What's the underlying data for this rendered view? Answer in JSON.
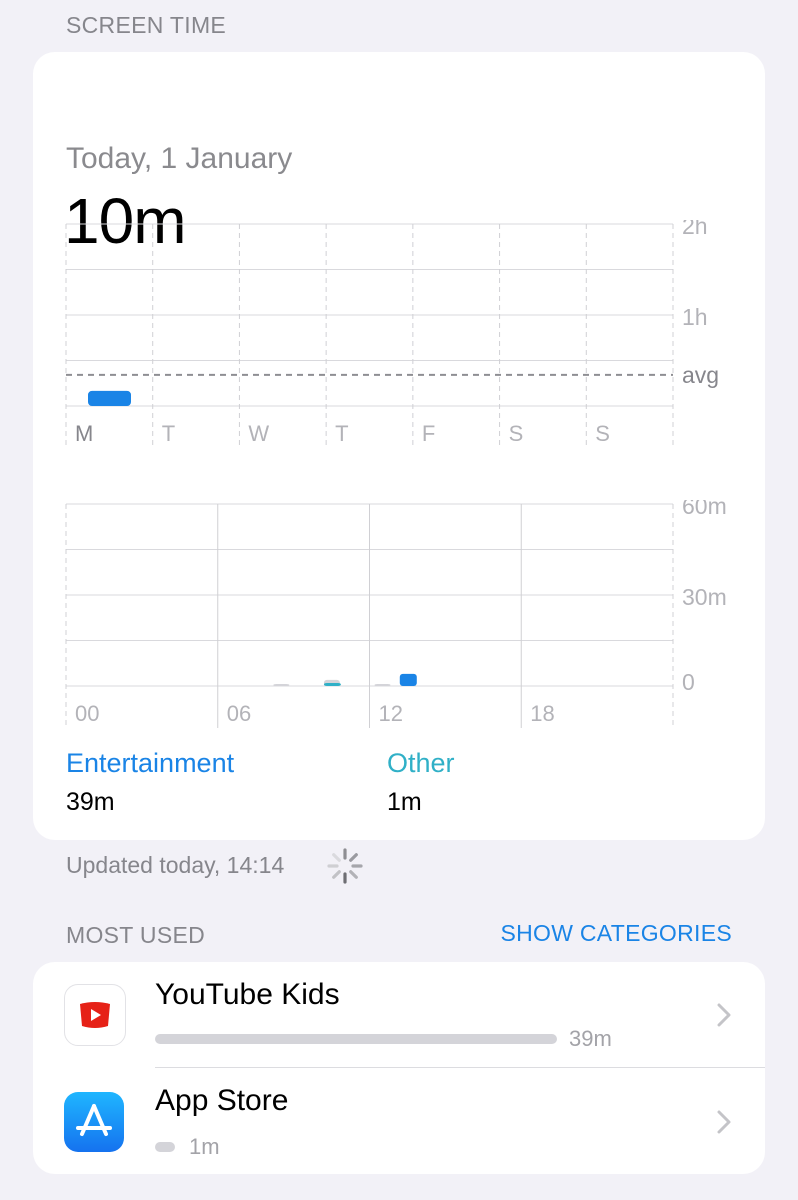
{
  "screen_time": {
    "section_title": "SCREEN TIME",
    "date_label": "Today, 1 January",
    "total": "10m"
  },
  "weekly_chart": {
    "days": [
      "M",
      "T",
      "W",
      "T",
      "F",
      "S",
      "S"
    ],
    "y_tick_labels": [
      "2h",
      "1h"
    ],
    "avg_label": "avg"
  },
  "hourly_chart": {
    "hour_labels": [
      "00",
      "06",
      "12",
      "18"
    ],
    "y_tick_labels": [
      "60m",
      "30m",
      "0"
    ]
  },
  "chart_data": [
    {
      "type": "bar",
      "categories": [
        "M",
        "T",
        "W",
        "T",
        "F",
        "S",
        "S"
      ],
      "values_minutes": [
        10,
        0,
        0,
        0,
        0,
        0,
        0
      ],
      "average_minutes": 10,
      "ylim_minutes": [
        0,
        120
      ],
      "y_ticks": [
        "2h",
        "1h"
      ]
    },
    {
      "type": "bar",
      "x_labels": [
        "00",
        "06",
        "12",
        "18"
      ],
      "ylim_minutes": [
        0,
        60
      ],
      "y_ticks": [
        "60m",
        "30m",
        "0"
      ],
      "series": [
        {
          "name": "Entertainment",
          "color": "#1a84e6",
          "points": [
            {
              "hour": 13,
              "minutes": 4
            }
          ]
        },
        {
          "name": "Other",
          "color": "#30b0c7",
          "points": [
            {
              "hour": 10,
              "minutes": 1
            }
          ]
        }
      ],
      "uncategorized": {
        "color": "#d4d4d9",
        "points": [
          {
            "hour": 8,
            "minutes": 0.2
          },
          {
            "hour": 10,
            "minutes": 2
          },
          {
            "hour": 12,
            "minutes": 0.2
          }
        ]
      }
    }
  ],
  "legend": [
    {
      "label": "Entertainment",
      "value": "39m",
      "color": "#1a84e6"
    },
    {
      "label": "Other",
      "value": "1m",
      "color": "#30b0c7"
    }
  ],
  "updated_text": "Updated today, 14:14",
  "most_used": {
    "section_title": "MOST USED",
    "show_categories_label": "SHOW CATEGORIES",
    "apps": [
      {
        "name": "YouTube Kids",
        "duration": "39m",
        "usage_fraction": 1.0
      },
      {
        "name": "App Store",
        "duration": "1m",
        "usage_fraction": 0.05
      }
    ]
  }
}
